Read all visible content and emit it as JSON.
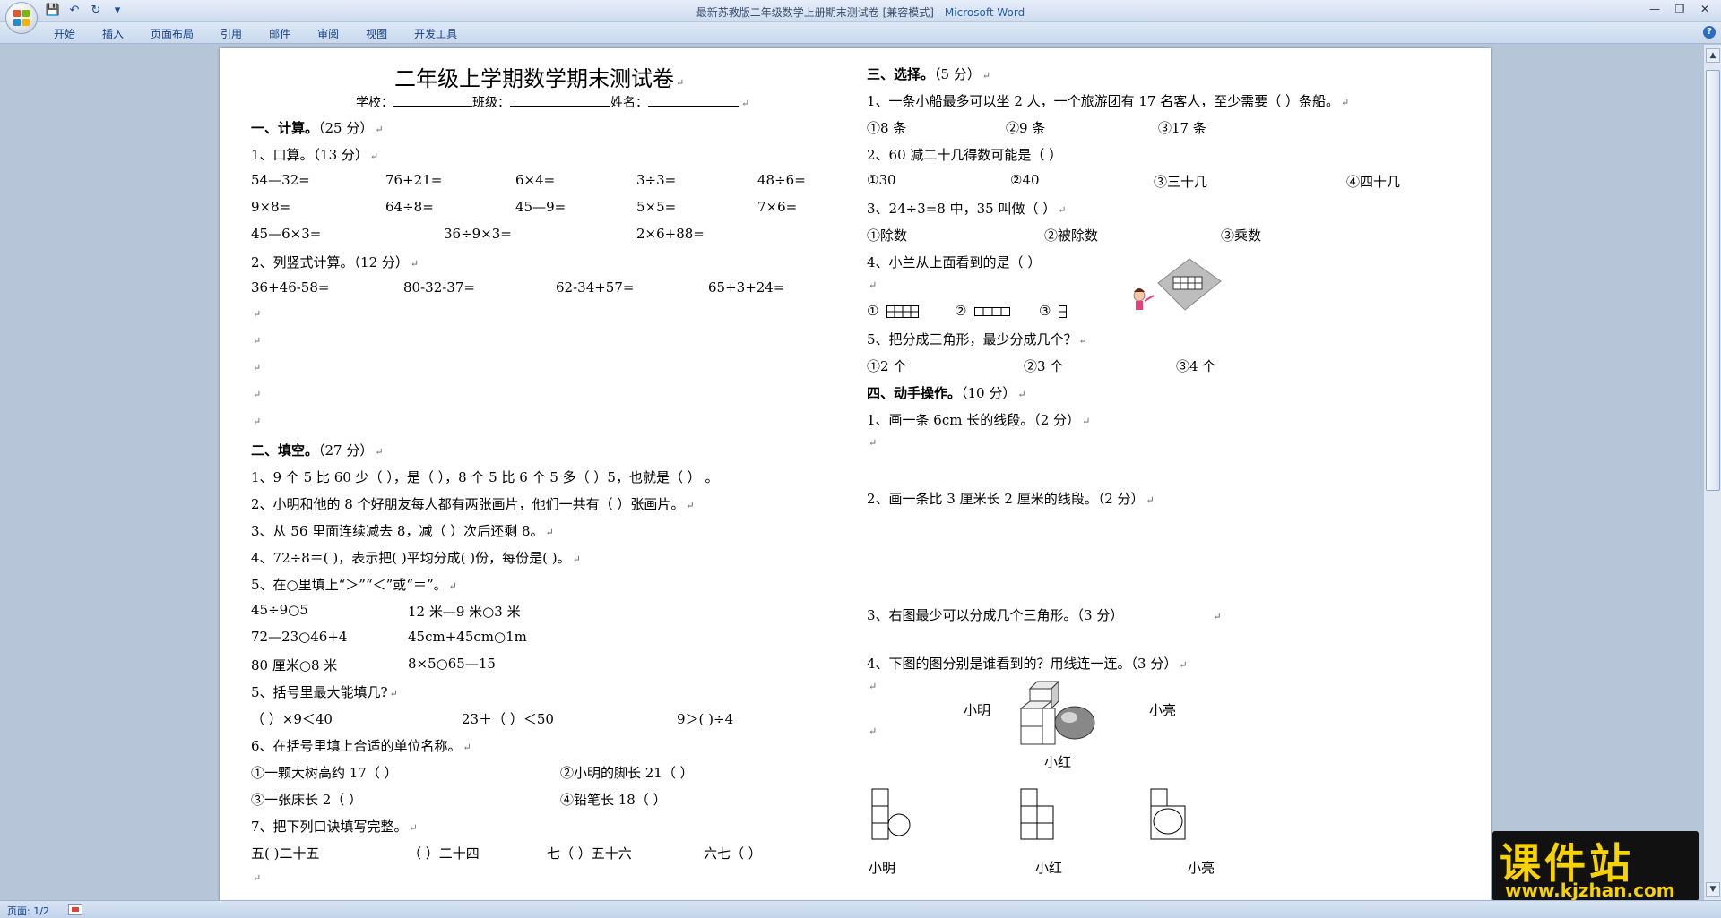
{
  "window": {
    "title_doc": "最新苏教版二年级数学上册期末测试卷 [兼容模式] - ",
    "title_app": "Microsoft Word"
  },
  "ribbon": {
    "tabs": [
      "开始",
      "插入",
      "页面布局",
      "引用",
      "邮件",
      "审阅",
      "视图",
      "开发工具"
    ]
  },
  "status": {
    "page": "页面: 1/2"
  },
  "watermark": {
    "brand": "课件站",
    "url": "www.kjzhan.com"
  },
  "doc": {
    "title": "二年级上学期数学期末测试卷",
    "school": "学校：",
    "class_": "班级：",
    "name": "姓名：",
    "s1": {
      "heading": "一、计算。",
      "score": "（25 分）",
      "q1_label": "1、口算。（13 分）",
      "row1": [
        "54—32=",
        "76+21=",
        "6×4=",
        "3÷3=",
        "48÷6="
      ],
      "row2": [
        "9×8=",
        "64÷8=",
        "45—9=",
        "5×5=",
        "7×6="
      ],
      "row3": [
        "45—6×3=",
        "36÷9×3=",
        "2×6+88="
      ],
      "q2_label": "2、列竖式计算。（12 分）",
      "row4": [
        "36+46-58=",
        "80-32-37=",
        "62-34+57=",
        "65+3+24="
      ]
    },
    "s2": {
      "heading": "二、填空。",
      "score": "（27 分）",
      "q1": "1、9 个 5 比 60 少（    ），是（    ），8 个 5 比 6 个 5 多（    ）5，也就是（    ）   。",
      "q2": "2、小明和他的 8 个好朋友每人都有两张画片，他们一共有（    ）张画片。",
      "q3": "3、从 56 里面连续减去 8，减（    ）次后还剩 8。",
      "q4": "4、72÷8＝(    )，表示把(    )平均分成(    )份，每份是(    )。",
      "q5": "5、在○里填上“＞”“＜”或“＝”。",
      "c1": [
        "45÷9○5",
        "12 米—9 米○3 米"
      ],
      "c2": [
        "72—23○46+4",
        "45cm+45cm○1m"
      ],
      "c3": [
        "80 厘米○8 米",
        "8×5○65—15"
      ],
      "q6": "5、括号里最大能填几?",
      "m1": [
        "（      ）×9＜40",
        "23＋（     ）＜50",
        "9＞(           )÷4"
      ],
      "q7": "6、在括号里填上合适的单位名称。",
      "u1": [
        "①一颗大树高约 17（        ）",
        "②小明的脚长 21（        ）"
      ],
      "u2": [
        "③一张床长 2（        ）",
        "④铅笔长 18（        ）"
      ],
      "q8": "7、把下列口诀填写完整。",
      "k1": [
        "五(    )二十五",
        "（      ）二十四",
        "七（     ）五十六",
        "六七（            ）"
      ]
    },
    "s3": {
      "heading": "三、选择。",
      "score": "（5 分）",
      "q1": "1、一条小船最多可以坐 2 人，一个旅游团有 17 名客人，至少需要（          ）条船。",
      "a1": [
        "①8 条",
        "②9 条",
        "③17 条"
      ],
      "q2": "2、60 减二十几得数可能是（          ）",
      "a2": [
        "①30",
        "②40",
        "③三十几",
        "④四十几"
      ],
      "q3": "3、24÷3=8 中，35 叫做（          ）",
      "a3": [
        "①除数",
        "②被除数",
        "③乘数"
      ],
      "q4": "4、小兰从上面看到的是（          ）",
      "a4": [
        "①",
        "②",
        "③"
      ],
      "q5": "5、把分成三角形，最少分成几个？",
      "a5": [
        "①2 个",
        "②3 个",
        "③4 个"
      ]
    },
    "s4": {
      "heading": "四、动手操作。",
      "score": "（10 分）",
      "q1": "1、画一条 6cm 长的线段。（2 分）",
      "q2": "2、画一条比 3 厘米长 2 厘米的线段。（2 分）",
      "q3": "3、右图最少可以分成几个三角形。（3 分）",
      "q4": "4、下图的图分别是谁看到的？用线连一连。（3 分）",
      "names_top": [
        "小明",
        "小亮",
        "小红"
      ],
      "names_bottom": [
        "小明",
        "小红",
        "小亮"
      ]
    }
  }
}
